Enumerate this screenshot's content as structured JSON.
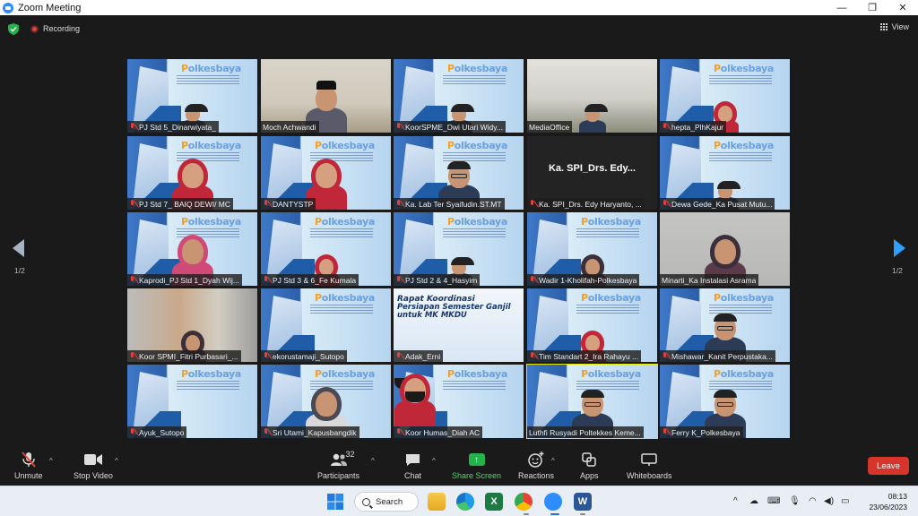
{
  "window": {
    "title": "Zoom Meeting",
    "controls": [
      "—",
      "❐",
      "✕"
    ]
  },
  "topbar": {
    "recording_label": "Recording",
    "view_label": "View"
  },
  "tiles": [
    {
      "name": "PJ Std 5_Dinarwiyata_",
      "bg": "banner",
      "person": "man small",
      "muted": true
    },
    {
      "name": "Moch Achwandi",
      "bg": "office",
      "person": "cap",
      "muted": false
    },
    {
      "name": "KoorSPME_Dwi Utari Widy...",
      "bg": "banner",
      "person": "man small",
      "muted": true
    },
    {
      "name": "MediaOffice",
      "bg": "room",
      "person": "man small",
      "muted": false
    },
    {
      "name": "hepta_PlhKajur",
      "bg": "banner",
      "person": "hijab small",
      "muted": true
    },
    {
      "name": "PJ Std 7_ BAIQ DEWI/ MC",
      "bg": "banner",
      "person": "hijab",
      "muted": true
    },
    {
      "name": "DANTYSTP",
      "bg": "banner",
      "person": "hijab",
      "muted": true
    },
    {
      "name": "Ka. Lab Ter Syaifudin.ST.MT",
      "bg": "banner",
      "person": "man",
      "muted": true
    },
    {
      "name": "Ka. SPI_Drs. Edy Haryanto, ...",
      "bg": "dark",
      "person": "",
      "muted": true,
      "center": "Ka. SPI_Drs. Edy..."
    },
    {
      "name": "Dewa Gede_Ka Pusat Mutu...",
      "bg": "banner",
      "person": "man small",
      "muted": true
    },
    {
      "name": "Kaprodi_PJ Std 1_Dyah Wij...",
      "bg": "banner",
      "person": "hijab-pink",
      "muted": true
    },
    {
      "name": "PJ Std 3 & 6_Fe Kumala",
      "bg": "banner",
      "person": "hijab small",
      "muted": true
    },
    {
      "name": "PJ Std 2 & 4_Hasyim",
      "bg": "banner",
      "person": "man small",
      "muted": true
    },
    {
      "name": "Wadir 1-Kholifah-Polkesbaya",
      "bg": "banner",
      "person": "hijab-dark small",
      "muted": true
    },
    {
      "name": "Minarti_Ka Instalasi Asrama",
      "bg": "wall",
      "person": "hijab-dark",
      "muted": false
    },
    {
      "name": "Koor SPMI_Fitri Purbasari_...",
      "bg": "home",
      "person": "hijab-dark small",
      "muted": true
    },
    {
      "name": "ekorustamaji_Sutopo",
      "bg": "banner",
      "person": "",
      "muted": true
    },
    {
      "name": "Adak_Erni",
      "bg": "rapat",
      "person": "",
      "muted": true,
      "rapat": [
        "Rapat Koordinasi",
        "Persiapan Semester Ganjil",
        "untuk MK MKDU"
      ]
    },
    {
      "name": "Tim Standart 2_Ira Rahayu ...",
      "bg": "banner",
      "person": "hijab small",
      "muted": true
    },
    {
      "name": "Mishawar_Kanit Perpustaka...",
      "bg": "banner",
      "person": "man",
      "muted": true
    },
    {
      "name": "Ayuk_Sutopo",
      "bg": "banner",
      "person": "",
      "muted": true
    },
    {
      "name": "Sri Utami_Kapusbangdik",
      "bg": "banner",
      "person": "hijab-grey",
      "muted": true
    },
    {
      "name": "Koor Humas_Diah AC",
      "bg": "banner",
      "person": "hijab mask",
      "muted": true
    },
    {
      "name": "Luthfi Rusyadi Poltekkes Keme...",
      "bg": "banner",
      "person": "man",
      "muted": false,
      "active": true
    },
    {
      "name": "Ferry K_Polkesbaya",
      "bg": "banner",
      "person": "man",
      "muted": true
    }
  ],
  "logo_text": "Polkesbaya",
  "pager": {
    "left": "1/2",
    "right": "1/2"
  },
  "toolbar": {
    "unmute": "Unmute",
    "stop_video": "Stop Video",
    "participants": "Participants",
    "participants_count": "32",
    "chat": "Chat",
    "share_screen": "Share Screen",
    "reactions": "Reactions",
    "apps": "Apps",
    "whiteboards": "Whiteboards",
    "leave": "Leave"
  },
  "taskbar": {
    "search": "Search",
    "time": "08:13",
    "date": "23/06/2023"
  },
  "colors": {
    "accent_blue": "#2d8cff",
    "leave_red": "#d5352b",
    "share_green": "#24b24c",
    "active_speaker": "#e6e600"
  }
}
